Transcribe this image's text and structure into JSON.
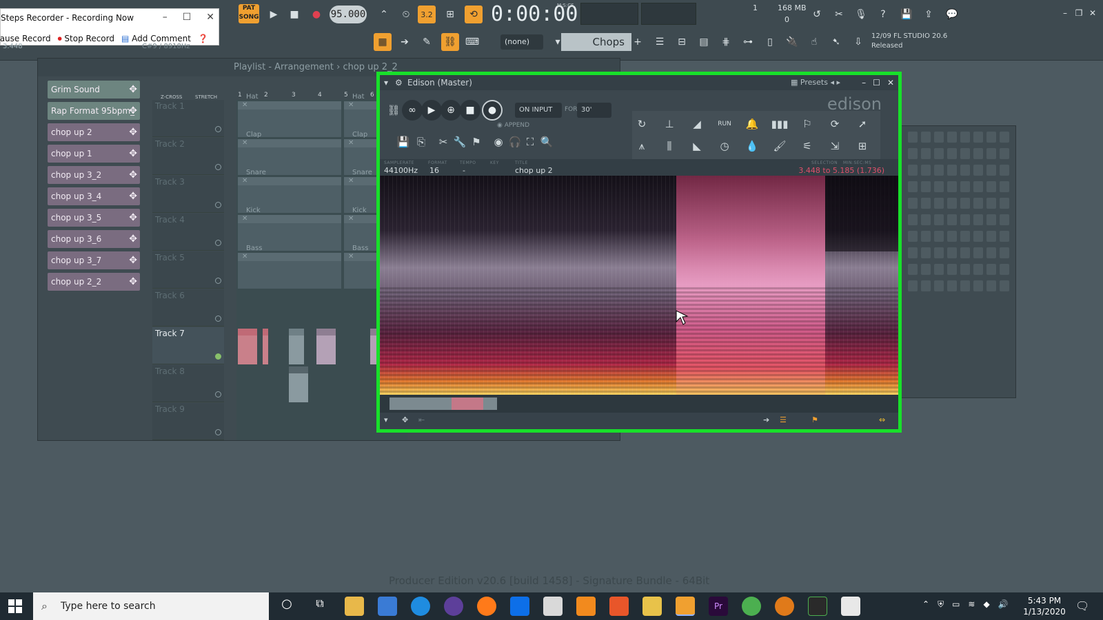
{
  "toolbar": {
    "pat_label": "PAT",
    "song_label": "SONG",
    "tempo": "95.000",
    "time": "0:00:00",
    "mcs": "M:S:CS",
    "pattern_select": "(none)",
    "pattern_name": "Chops",
    "mem_cores": "1",
    "mem_value": "168 MB",
    "mem_zero": "0",
    "news_date": "12/09",
    "news_title": "FL STUDIO 20.6",
    "news_status": "Released",
    "counter_value": "3.448",
    "note_text": "C#9 / 8918Hz"
  },
  "steps_recorder": {
    "title": "Steps Recorder - Recording Now",
    "pause_label": "Pause Record",
    "stop_label": "Stop Record",
    "comment_label": "Add Comment"
  },
  "playlist": {
    "title": "Playlist - Arrangement",
    "pattern": "chop up 2_2",
    "z_cross": "Z-CROSS",
    "stretch": "STRETCH",
    "ruler": [
      "1",
      "2",
      "3",
      "4",
      "5",
      "6"
    ],
    "patterns": [
      {
        "label": "Grim Sound"
      },
      {
        "label": "Rap Format 95bpm_"
      },
      {
        "label": "chop up 2"
      },
      {
        "label": "chop up 1"
      },
      {
        "label": "chop up 3_2"
      },
      {
        "label": "chop up 3_4"
      },
      {
        "label": "chop up 3_5"
      },
      {
        "label": "chop up 3_6"
      },
      {
        "label": "chop up 3_7"
      },
      {
        "label": "chop up 2_2"
      }
    ],
    "tracks": [
      "Track 1",
      "Track 2",
      "Track 3",
      "Track 4",
      "Track 5",
      "Track 6",
      "Track 7",
      "Track 8",
      "Track 9"
    ],
    "clip_labels": [
      "Hat",
      "Clap",
      "Snare",
      "Kick",
      "Bass"
    ]
  },
  "edison": {
    "title": "Edison (Master)",
    "presets": "Presets",
    "logo": "edison",
    "on_input": "ON INPUT",
    "for_label": "FOR",
    "for_value": "30'",
    "append": "APPEND",
    "info_labels": {
      "samplerate": "SAMPLERATE",
      "format": "FORMAT",
      "tempo": "TEMPO",
      "key": "KEY",
      "title": "TITLE",
      "selection": "SELECTION",
      "min_sec_ms": "MIN:SEC:MS"
    },
    "samplerate": "44100Hz",
    "format": "16",
    "tempo": "-",
    "title_value": "chop up 2",
    "selection": "3.448 to 5.185 (1.736)"
  },
  "footer": {
    "build": "Producer Edition v20.6 [build 1458] - Signature Bundle - 64Bit"
  },
  "taskbar": {
    "search_placeholder": "Type here to search",
    "time": "5:43 PM",
    "date": "1/13/2020"
  },
  "colors": {
    "highlight_border": "#18e02a",
    "accent_orange": "#f0a030",
    "selection_text": "#e0506a"
  }
}
